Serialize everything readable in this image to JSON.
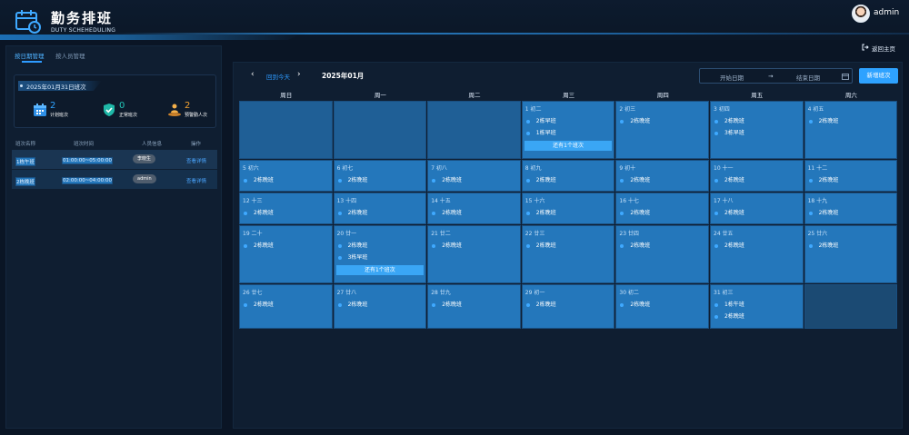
{
  "header": {
    "title": "勤务排班",
    "subtitle": "DUTY SCHEHEDULING",
    "username": "admin",
    "logo_icon": "calendar-clock-icon"
  },
  "left": {
    "tabs": [
      {
        "label": "按日期管理",
        "active": true
      },
      {
        "label": "按人员管理",
        "active": false
      }
    ],
    "summary": {
      "title": "2025年01月31日班次",
      "stats": [
        {
          "value": "2",
          "label": "计划班次",
          "icon": "calendar-icon",
          "color": "#2ea2ff"
        },
        {
          "value": "0",
          "label": "正常班次",
          "icon": "shield-check-icon",
          "color": "#22c7b8"
        },
        {
          "value": "2",
          "label": "预警勤人次",
          "icon": "person-stage-icon",
          "color": "#f0a030"
        }
      ]
    },
    "table": {
      "headers": [
        "班次名称",
        "班次时间",
        "人员信息",
        "操作"
      ],
      "rows": [
        {
          "name": "1栋午班",
          "time": "01:00:00~05:00:00",
          "person": "李晓生",
          "action": "查看详情"
        },
        {
          "name": "2栋晚班",
          "time": "02:00:00~04:00:00",
          "person": "admin",
          "action": "查看详情"
        }
      ]
    }
  },
  "return_label": "返回主页",
  "calendar": {
    "prev_icon": "chevron-left-icon",
    "next_icon": "chevron-right-icon",
    "today_label": "回到今天",
    "month": "2025年01月",
    "start_placeholder": "开始日期",
    "arrow": "→",
    "end_placeholder": "结束日期",
    "new_label": "新增班次",
    "weekdays": [
      "周日",
      "周一",
      "周二",
      "周三",
      "周四",
      "周五",
      "周六"
    ],
    "weeks": [
      [
        {
          "kind": "empty"
        },
        {
          "kind": "empty"
        },
        {
          "kind": "empty"
        },
        {
          "kind": "day",
          "label": "1  初二",
          "shifts": [
            "2栋早班",
            "1栋早班"
          ],
          "more": "还有1个班次"
        },
        {
          "kind": "day",
          "label": "2  初三",
          "shifts": [
            "2栋晚班"
          ]
        },
        {
          "kind": "day",
          "label": "3  初四",
          "shifts": [
            "2栋晚班",
            "3栋早班"
          ]
        },
        {
          "kind": "day",
          "label": "4  初五",
          "shifts": [
            "2栋晚班"
          ]
        }
      ],
      [
        {
          "kind": "day",
          "label": "5  初六",
          "shifts": [
            "2栋晚班"
          ]
        },
        {
          "kind": "day",
          "label": "6  初七",
          "shifts": [
            "2栋晚班"
          ]
        },
        {
          "kind": "day",
          "label": "7  初八",
          "shifts": [
            "2栋晚班"
          ]
        },
        {
          "kind": "day",
          "label": "8  初九",
          "shifts": [
            "2栋晚班"
          ]
        },
        {
          "kind": "day",
          "label": "9  初十",
          "shifts": [
            "2栋晚班"
          ]
        },
        {
          "kind": "day",
          "label": "10  十一",
          "shifts": [
            "2栋晚班"
          ]
        },
        {
          "kind": "day",
          "label": "11  十二",
          "shifts": [
            "2栋晚班"
          ]
        }
      ],
      [
        {
          "kind": "day",
          "label": "12  十三",
          "shifts": [
            "2栋晚班"
          ]
        },
        {
          "kind": "day",
          "label": "13  十四",
          "shifts": [
            "2栋晚班"
          ]
        },
        {
          "kind": "day",
          "label": "14  十五",
          "shifts": [
            "2栋晚班"
          ]
        },
        {
          "kind": "day",
          "label": "15  十六",
          "shifts": [
            "2栋晚班"
          ]
        },
        {
          "kind": "day",
          "label": "16  十七",
          "shifts": [
            "2栋晚班"
          ]
        },
        {
          "kind": "day",
          "label": "17  十八",
          "shifts": [
            "2栋晚班"
          ]
        },
        {
          "kind": "day",
          "label": "18  十九",
          "shifts": [
            "2栋晚班"
          ]
        }
      ],
      [
        {
          "kind": "day",
          "label": "19  二十",
          "shifts": [
            "2栋晚班"
          ]
        },
        {
          "kind": "day",
          "label": "20  廿一",
          "shifts": [
            "2栋晚班",
            "3栋早班"
          ],
          "more": "还有1个班次"
        },
        {
          "kind": "day",
          "label": "21  廿二",
          "shifts": [
            "2栋晚班"
          ]
        },
        {
          "kind": "day",
          "label": "22  廿三",
          "shifts": [
            "2栋晚班"
          ]
        },
        {
          "kind": "day",
          "label": "23  廿四",
          "shifts": [
            "2栋晚班"
          ]
        },
        {
          "kind": "day",
          "label": "24  廿五",
          "shifts": [
            "2栋晚班"
          ]
        },
        {
          "kind": "day",
          "label": "25  廿六",
          "shifts": [
            "2栋晚班"
          ]
        }
      ],
      [
        {
          "kind": "day",
          "label": "26  廿七",
          "shifts": [
            "2栋晚班"
          ]
        },
        {
          "kind": "day",
          "label": "27  廿八",
          "shifts": [
            "2栋晚班"
          ]
        },
        {
          "kind": "day",
          "label": "28  廿九",
          "shifts": [
            "2栋晚班"
          ]
        },
        {
          "kind": "day",
          "label": "29  初一",
          "shifts": [
            "2栋晚班"
          ]
        },
        {
          "kind": "day",
          "label": "30  初二",
          "shifts": [
            "2栋晚班"
          ]
        },
        {
          "kind": "day",
          "label": "31  初三",
          "shifts": [
            "1栋午班",
            "2栋晚班"
          ]
        },
        {
          "kind": "disabled"
        }
      ]
    ]
  }
}
